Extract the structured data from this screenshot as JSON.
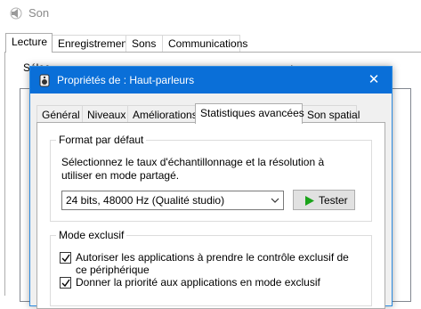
{
  "background_window": {
    "title": "Son",
    "icon": "speaker-icon",
    "tabs": [
      "Lecture",
      "Enregistrement",
      "Sons",
      "Communications"
    ],
    "active_tab": "Lecture",
    "partial_text": "Sélec ... ... ... ... ... ... ... ... ... ... ... ... ... ... ... ... ... ... ... ... :"
  },
  "dialog": {
    "title": "Propriétés de : Haut-parleurs",
    "icon": "speaker-icon",
    "close_glyph": "✕",
    "tabs": [
      "Général",
      "Niveaux",
      "Améliorations",
      "Statistiques avancées",
      "Son spatial"
    ],
    "active_tab": "Statistiques avancées",
    "default_format": {
      "label": "Format par défaut",
      "description": "Sélectionnez le taux d'échantillonnage et la résolution à utiliser en mode partagé.",
      "selected": "24 bits, 48000 Hz (Qualité studio)",
      "test_button": "Tester",
      "test_icon": "play-icon"
    },
    "exclusive_mode": {
      "label": "Mode exclusif",
      "options": [
        {
          "label": "Autoriser les applications à prendre le contrôle exclusif de ce périphérique",
          "checked": true
        },
        {
          "label": "Donner la priorité aux applications en mode exclusif",
          "checked": true
        }
      ]
    }
  },
  "colors": {
    "titlebar": "#0a6fd8",
    "play_green": "#1aa31a",
    "panel_bg": "#f0f0f0"
  }
}
